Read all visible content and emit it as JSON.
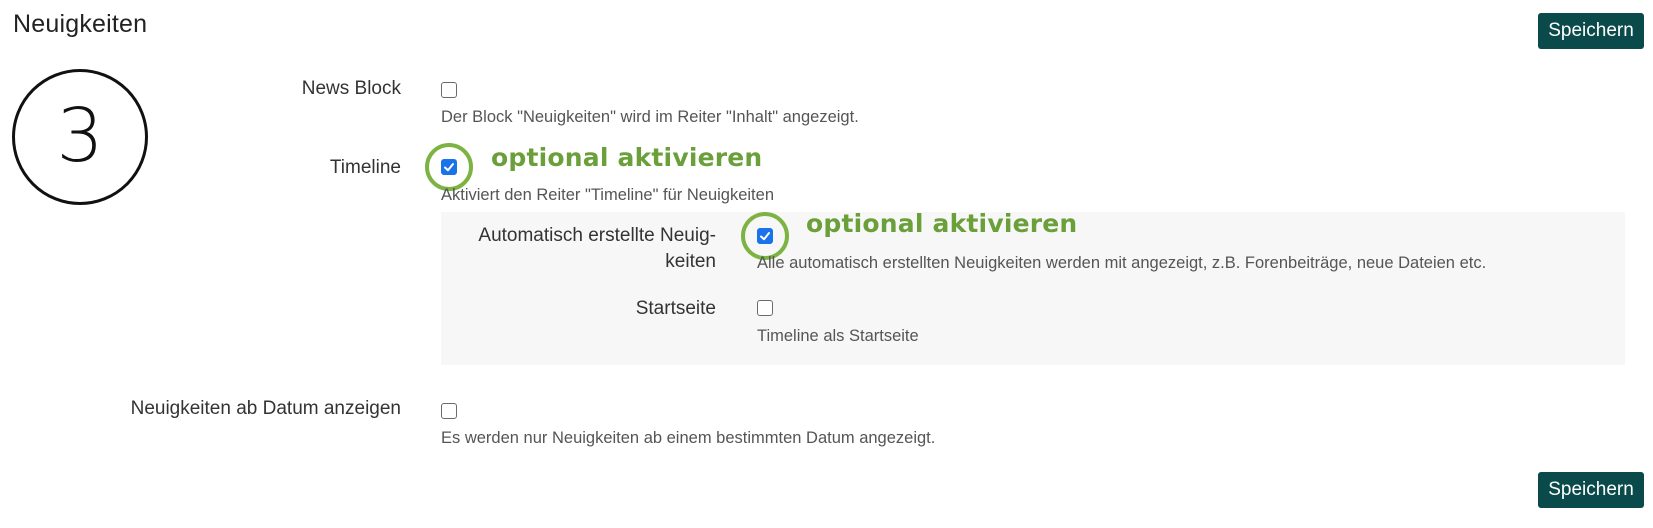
{
  "page": {
    "title": "Neuigkeiten"
  },
  "actions": {
    "save_label": "Speichern"
  },
  "step": {
    "number": "3"
  },
  "annotation": {
    "text": "optional aktivieren",
    "color": "#6a9f3a"
  },
  "settings": {
    "news_block": {
      "label": "News Block",
      "checked": false,
      "help": "Der Block \"Neuigkeiten\" wird im Reiter \"Inhalt\" angezeigt."
    },
    "timeline": {
      "label": "Timeline",
      "checked": true,
      "help": "Aktiviert den Reiter \"Timeline\" für Neuigkeiten"
    },
    "auto_news": {
      "label_line1": "Automatisch erstellte Neuig-",
      "label_line2": "keiten",
      "checked": true,
      "help": "Alle automatisch erstellten Neuigkeiten werden mit angezeigt, z.B. Forenbeiträge, neue Dateien etc."
    },
    "startpage": {
      "label": "Startseite",
      "checked": false,
      "help": "Timeline als Startseite"
    },
    "news_from_date": {
      "label": "Neuigkeiten ab Datum anzeigen",
      "checked": false,
      "help": "Es werden nur Neuigkeiten ab einem bestimmten Datum angezeigt."
    }
  },
  "colors": {
    "primary_button": "#0b4a4a",
    "checkbox_checked": "#1a73e8",
    "highlight_ring": "#7cb342"
  }
}
